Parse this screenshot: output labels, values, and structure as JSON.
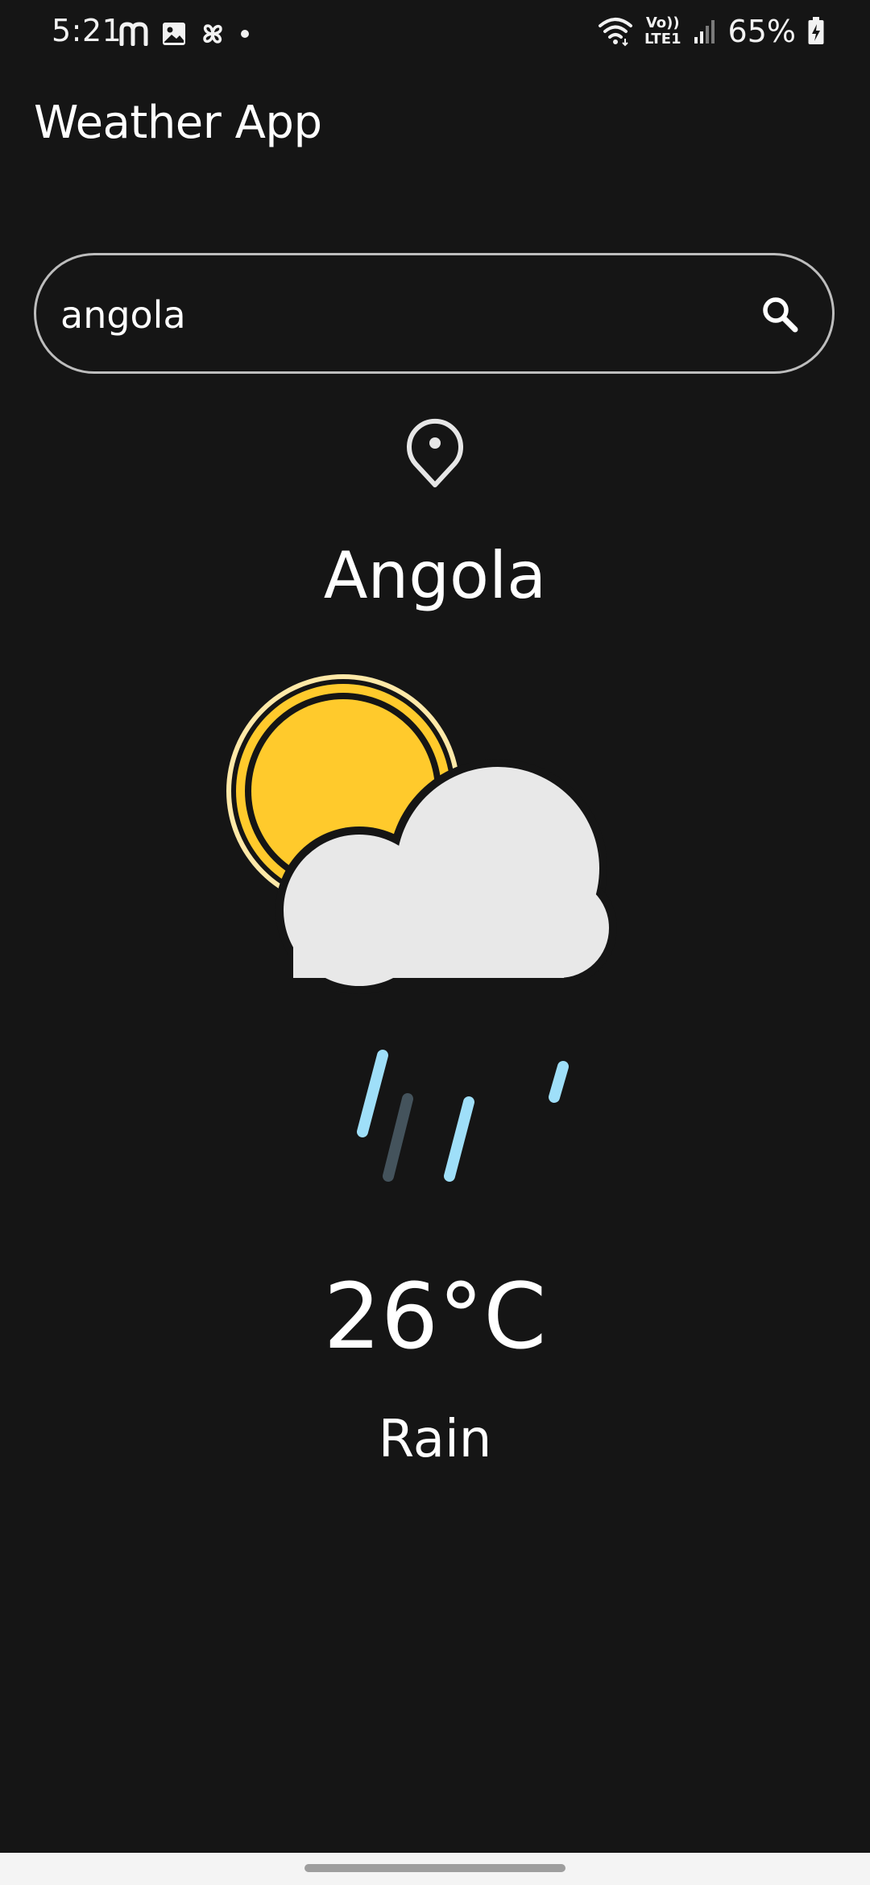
{
  "status_bar": {
    "time": "5:21",
    "lte_label_top": "Vo))",
    "lte_label_bottom": "LTE1",
    "battery_percent": "65%",
    "left_icons": [
      "m-icon",
      "gallery-icon",
      "pinwheel-icon",
      "dot-icon"
    ],
    "right_icons": [
      "wifi-icon",
      "volte-icon",
      "signal-icon",
      "battery-charging-icon"
    ]
  },
  "app_bar": {
    "title": "Weather App"
  },
  "search": {
    "value": "angola",
    "icon": "search-icon"
  },
  "location": {
    "icon": "location-pin-icon",
    "city": "Angola"
  },
  "weather": {
    "icon": "sun-cloud-rain-icon",
    "temperature": "26°C",
    "condition": "Rain"
  },
  "colors": {
    "background": "#151515",
    "sun": "#FFCA2C",
    "sun_ring": "#FFE9A8",
    "cloud": "#E8E8E8",
    "rain_light": "#9FDFF9",
    "rain_dark": "#44535C",
    "search_border": "#BDBDBD"
  }
}
